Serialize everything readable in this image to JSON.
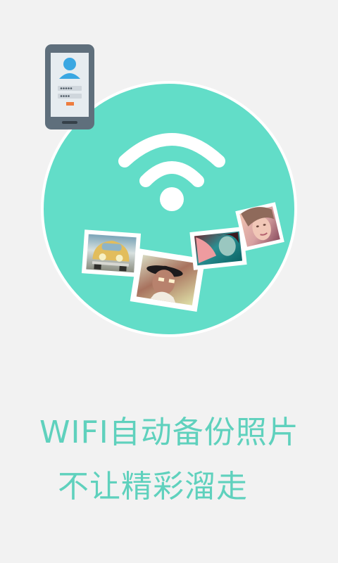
{
  "splash": {
    "title_line1": "WIFI自动备份照片",
    "title_line2": "不让精彩溜走"
  },
  "illustration": {
    "phone_icon": "phone-login-icon",
    "wifi_icon": "wifi-icon",
    "photos": [
      "car-photo",
      "girl-with-hat-photo",
      "teal-portrait-photo",
      "pink-portrait-photo"
    ]
  },
  "colors": {
    "background": "#f2f2f2",
    "circle": "#62ddc8",
    "circle_border": "#ffffff",
    "accent_text": "#5fd1bd",
    "phone_body": "#5f6f7c",
    "avatar": "#3aa7e2",
    "login_button": "#ee7d3f"
  }
}
